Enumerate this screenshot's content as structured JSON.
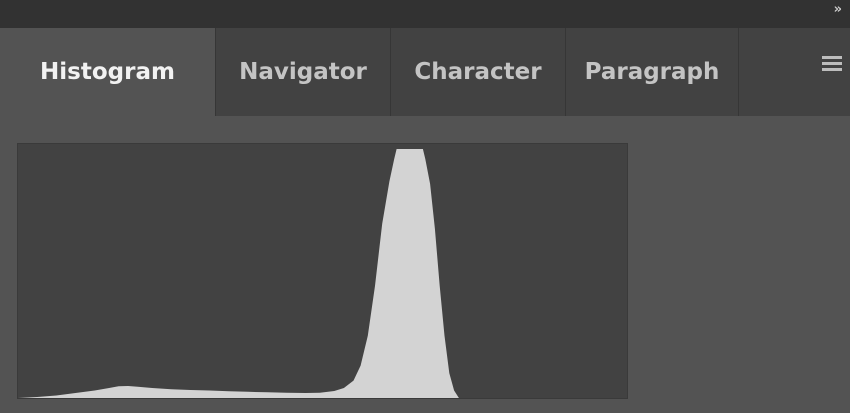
{
  "panel": {
    "tabs": [
      {
        "label": "Histogram",
        "active": true
      },
      {
        "label": "Navigator",
        "active": false
      },
      {
        "label": "Character",
        "active": false
      },
      {
        "label": "Paragraph",
        "active": false
      }
    ],
    "menu_icon": "hamburger-menu-icon",
    "collapse_icon": "double-chevron-right-icon"
  },
  "histogram": {
    "fill_color": "#d3d3d3",
    "background_color": "#424242",
    "levels": [
      [
        0,
        0
      ],
      [
        8,
        0.004
      ],
      [
        16,
        0.01
      ],
      [
        24,
        0.02
      ],
      [
        32,
        0.03
      ],
      [
        38,
        0.04
      ],
      [
        42,
        0.047
      ],
      [
        46,
        0.048
      ],
      [
        50,
        0.045
      ],
      [
        56,
        0.04
      ],
      [
        64,
        0.035
      ],
      [
        72,
        0.032
      ],
      [
        80,
        0.03
      ],
      [
        88,
        0.027
      ],
      [
        96,
        0.025
      ],
      [
        104,
        0.023
      ],
      [
        112,
        0.021
      ],
      [
        120,
        0.02
      ],
      [
        126,
        0.021
      ],
      [
        132,
        0.028
      ],
      [
        136,
        0.04
      ],
      [
        140,
        0.07
      ],
      [
        143,
        0.13
      ],
      [
        146,
        0.25
      ],
      [
        149,
        0.45
      ],
      [
        152,
        0.7
      ],
      [
        155,
        0.87
      ],
      [
        157,
        0.96
      ],
      [
        158,
        1
      ],
      [
        169,
        1
      ],
      [
        170,
        0.96
      ],
      [
        172,
        0.86
      ],
      [
        174,
        0.68
      ],
      [
        176,
        0.45
      ],
      [
        178,
        0.25
      ],
      [
        180,
        0.1
      ],
      [
        182,
        0.03
      ],
      [
        184,
        0
      ]
    ]
  }
}
